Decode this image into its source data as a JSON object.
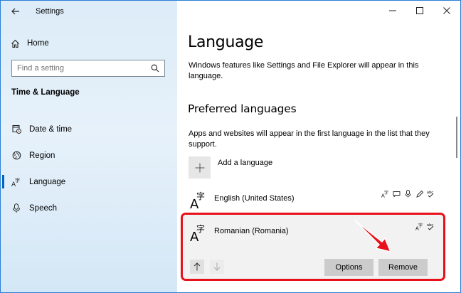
{
  "window": {
    "title": "Settings"
  },
  "sidebar": {
    "home_label": "Home",
    "search_placeholder": "Find a setting",
    "section_title": "Time & Language",
    "items": [
      {
        "label": "Date & time",
        "icon": "calendar-clock-icon"
      },
      {
        "label": "Region",
        "icon": "globe-icon"
      },
      {
        "label": "Language",
        "icon": "language-icon",
        "active": true
      },
      {
        "label": "Speech",
        "icon": "microphone-icon"
      }
    ]
  },
  "main": {
    "title": "Language",
    "description": "Windows features like Settings and File Explorer will appear in this language.",
    "preferred_title": "Preferred languages",
    "preferred_description": "Apps and websites will appear in the first language in the list that they support.",
    "add_language_label": "Add a language",
    "languages": [
      {
        "name": "English (United States)"
      },
      {
        "name": "Romanian (Romania)"
      }
    ],
    "options_label": "Options",
    "remove_label": "Remove"
  },
  "colors": {
    "accent": "#0067c0",
    "highlight": "#e8101a",
    "sidebar_bg": "#dcecf8"
  }
}
